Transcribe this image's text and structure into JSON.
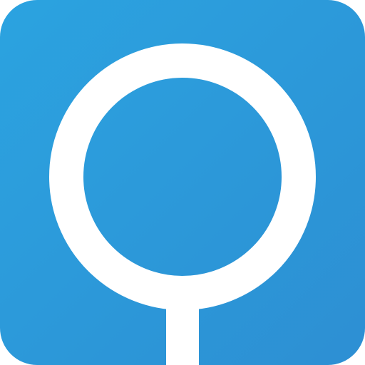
{
  "icon": {
    "name": "location-pin-icon",
    "colors": {
      "gradient_start": "#2ba3e0",
      "gradient_end": "#2d8fd3",
      "glyph": "#ffffff"
    }
  }
}
